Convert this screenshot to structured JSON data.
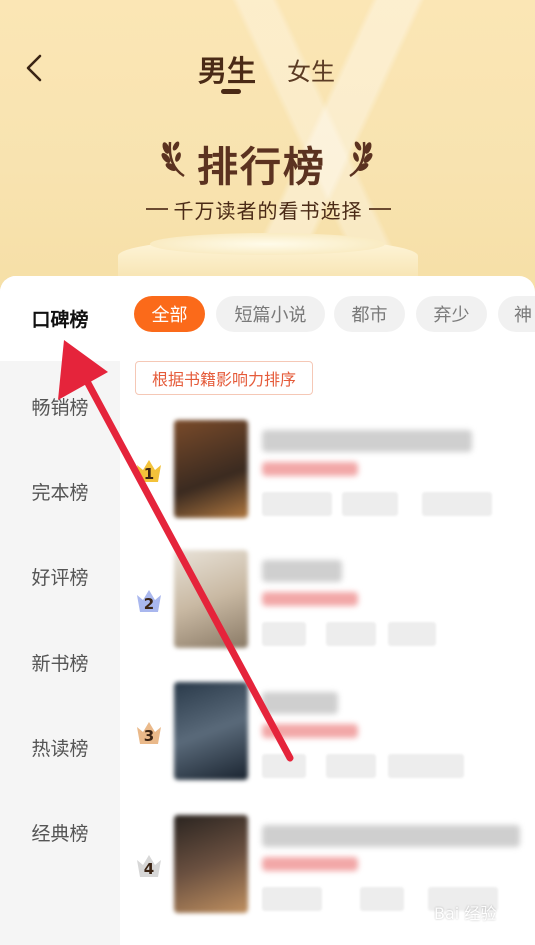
{
  "header": {
    "tabs": [
      {
        "label": "男生",
        "active": true
      },
      {
        "label": "女生",
        "active": false
      }
    ],
    "title": "排行榜",
    "subtitle": "千万读者的看书选择"
  },
  "sidebar": {
    "items": [
      {
        "label": "口碑榜",
        "active": true
      },
      {
        "label": "畅销榜",
        "active": false
      },
      {
        "label": "完本榜",
        "active": false
      },
      {
        "label": "好评榜",
        "active": false
      },
      {
        "label": "新书榜",
        "active": false
      },
      {
        "label": "热读榜",
        "active": false
      },
      {
        "label": "经典榜",
        "active": false
      }
    ]
  },
  "filters": {
    "chips": [
      {
        "label": "全部",
        "active": true
      },
      {
        "label": "短篇小说",
        "active": false
      },
      {
        "label": "都市",
        "active": false
      },
      {
        "label": "弃少",
        "active": false
      },
      {
        "label": "神",
        "active": false
      }
    ]
  },
  "sort_label": "根据书籍影响力排序",
  "books": [
    {
      "rank": "1",
      "crown_color": "#f3c23a"
    },
    {
      "rank": "2",
      "crown_color": "#a9b7ee"
    },
    {
      "rank": "3",
      "crown_color": "#eab98a"
    },
    {
      "rank": "4",
      "crown_color": "#d7d7d7"
    }
  ],
  "colors": {
    "accent": "#fb6a1a",
    "arrow": "#e5243b"
  },
  "watermark": {
    "text": "Bai 经验"
  }
}
